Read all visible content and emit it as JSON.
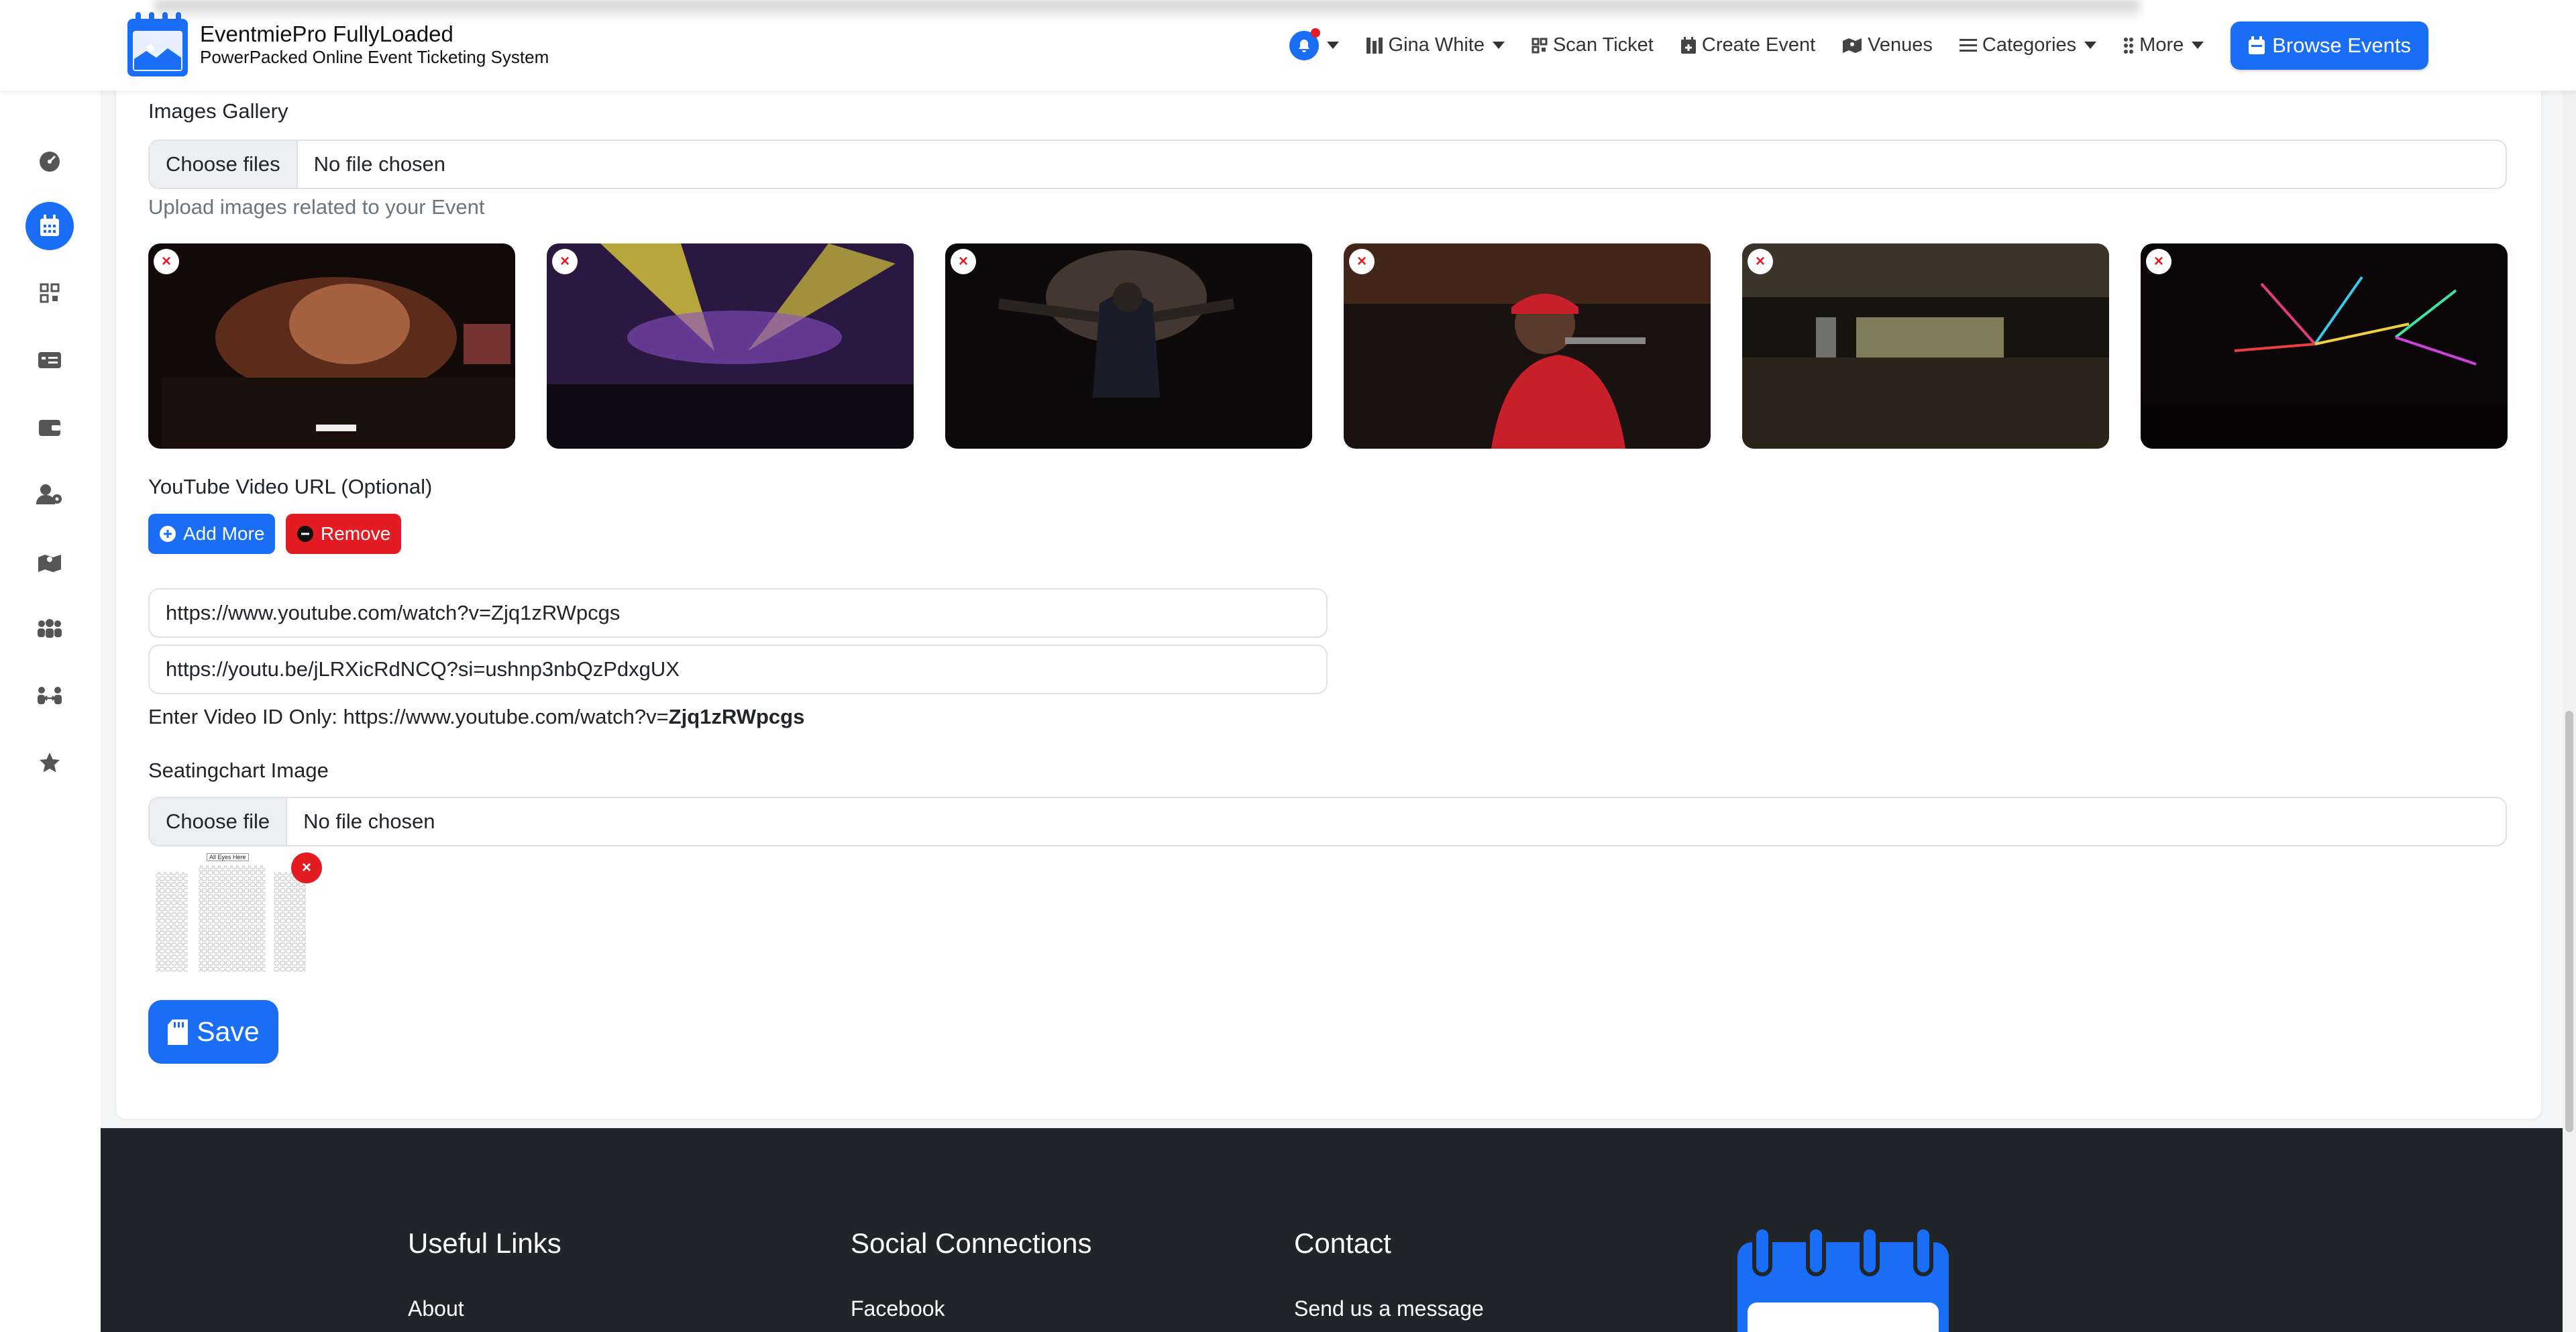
{
  "header": {
    "brand_title": "EventmiePro FullyLoaded",
    "brand_subtitle": "PowerPacked Online Event Ticketing System",
    "nav": {
      "user": "Gina White",
      "scan_ticket": "Scan Ticket",
      "create_event": "Create Event",
      "venues": "Venues",
      "categories": "Categories",
      "more": "More",
      "browse_events": "Browse Events"
    }
  },
  "form": {
    "gallery": {
      "label": "Images Gallery",
      "choose_button": "Choose files",
      "file_status": "No file chosen",
      "help": "Upload images related to your Event",
      "remove_icon": "×"
    },
    "youtube": {
      "label": "YouTube Video URL (Optional)",
      "add_more": "Add More",
      "remove": "Remove",
      "urls": [
        "https://www.youtube.com/watch?v=Zjq1zRWpcgs",
        "https://youtu.be/jLRXicRdNCQ?si=ushnp3nbQzPdxgUX"
      ],
      "hint_prefix": "Enter Video ID Only: https://www.youtube.com/watch?v=",
      "hint_id": "Zjq1zRWpcgs"
    },
    "seating": {
      "label": "Seatingchart Image",
      "choose_button": "Choose file",
      "file_status": "No file chosen",
      "chart_caption": "All Eyes Here",
      "remove_icon": "×"
    },
    "save": "Save"
  },
  "footer": {
    "useful_links": "Useful Links",
    "social": "Social Connections",
    "contact": "Contact",
    "about": "About",
    "facebook": "Facebook",
    "send_message": "Send us a message"
  },
  "colors": {
    "primary": "#1a6ef5",
    "danger": "#e31b23",
    "footer": "#212529"
  }
}
